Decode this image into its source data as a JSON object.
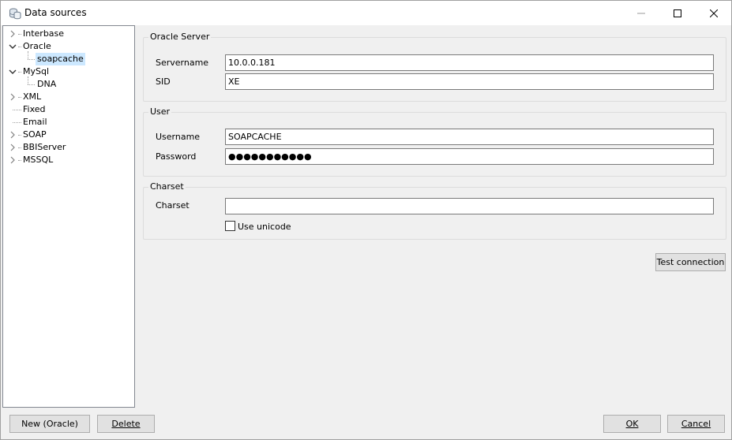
{
  "window": {
    "title": "Data sources"
  },
  "tree": {
    "items": [
      {
        "label": "Interbase"
      },
      {
        "label": "Oracle"
      },
      {
        "label": "soapcache"
      },
      {
        "label": "MySql"
      },
      {
        "label": "DNA"
      },
      {
        "label": "XML"
      },
      {
        "label": "Fixed"
      },
      {
        "label": "Email"
      },
      {
        "label": "SOAP"
      },
      {
        "label": "BBIServer"
      },
      {
        "label": "MSSQL"
      }
    ],
    "selected": "soapcache"
  },
  "oracle_server": {
    "title": "Oracle Server",
    "servername_label": "Servername",
    "servername_value": "10.0.0.181",
    "sid_label": "SID",
    "sid_value": "XE"
  },
  "user": {
    "title": "User",
    "username_label": "Username",
    "username_value": "SOAPCACHE",
    "password_label": "Password",
    "password_mask": "●●●●●●●●●●●"
  },
  "charset": {
    "title": "Charset",
    "charset_label": "Charset",
    "charset_value": "",
    "use_unicode_label": "Use unicode",
    "use_unicode_checked": false
  },
  "buttons": {
    "test_connection": "Test connection",
    "new_prefix": "New (Oracle)",
    "delete": "Delete",
    "ok": "OK",
    "cancel": "Cancel"
  },
  "colors": {
    "selection": "#cce8ff",
    "button_face": "#e1e1e1",
    "window_bg": "#f0f0f0"
  }
}
